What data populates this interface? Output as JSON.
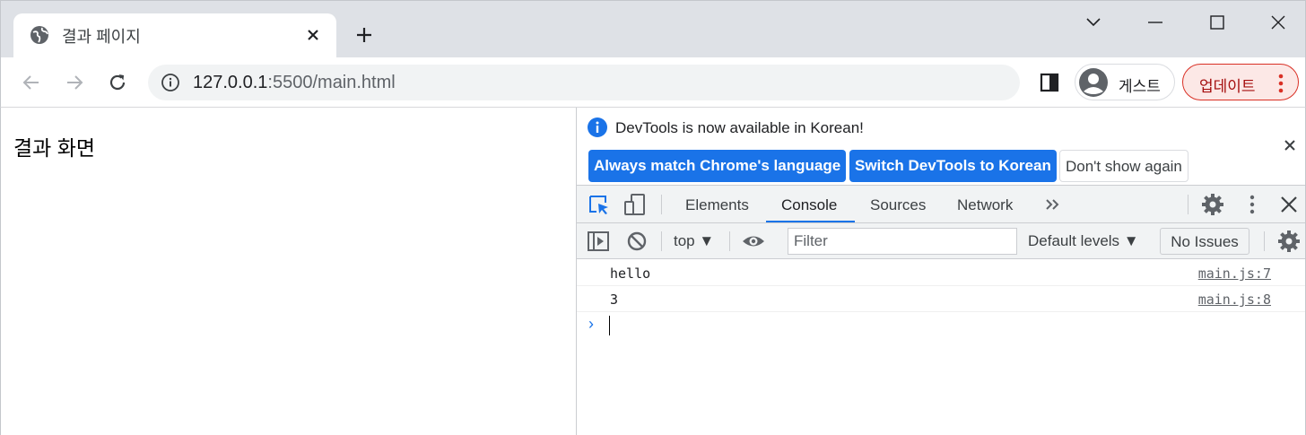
{
  "browser": {
    "tab_title": "결과 페이지",
    "url_host": "127.0.0.1",
    "url_rest": ":5500/main.html",
    "profile_name": "게스트",
    "update_label": "업데이트"
  },
  "page": {
    "heading": "결과 화면"
  },
  "devtools": {
    "infobar": {
      "message": "DevTools is now available in Korean!",
      "btn_match": "Always match Chrome's language",
      "btn_switch": "Switch DevTools to Korean",
      "btn_dismiss": "Don't show again"
    },
    "tabs": [
      "Elements",
      "Console",
      "Sources",
      "Network"
    ],
    "active_tab": "Console",
    "console_bar": {
      "context": "top",
      "filter_placeholder": "Filter",
      "levels": "Default levels",
      "issues": "No Issues"
    },
    "logs": [
      {
        "message": "hello",
        "source": "main.js:7"
      },
      {
        "message": "3",
        "source": "main.js:8"
      }
    ]
  },
  "colors": {
    "accent": "#1a73e8",
    "update_border": "#d93025",
    "update_bg": "#fce8e6",
    "tabstrip": "#dee1e6"
  }
}
